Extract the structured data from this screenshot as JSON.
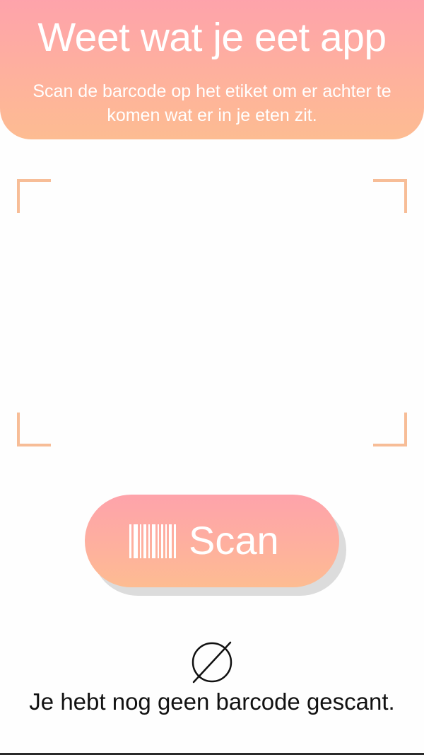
{
  "header": {
    "title": "Weet wat je eet app",
    "subtitle": "Scan de barcode op het etiket om er achter te komen wat er in je eten zit."
  },
  "scanner": {
    "frame_color": "#f7bd97"
  },
  "scan_button": {
    "label": "Scan",
    "icon": "barcode-icon"
  },
  "status": {
    "icon": "empty-set-icon",
    "message": "Je hebt nog geen barcode gescant."
  },
  "colors": {
    "gradient_top": "#fea3ab",
    "gradient_bottom": "#fdbc92",
    "text_on_accent": "#ffffff"
  }
}
